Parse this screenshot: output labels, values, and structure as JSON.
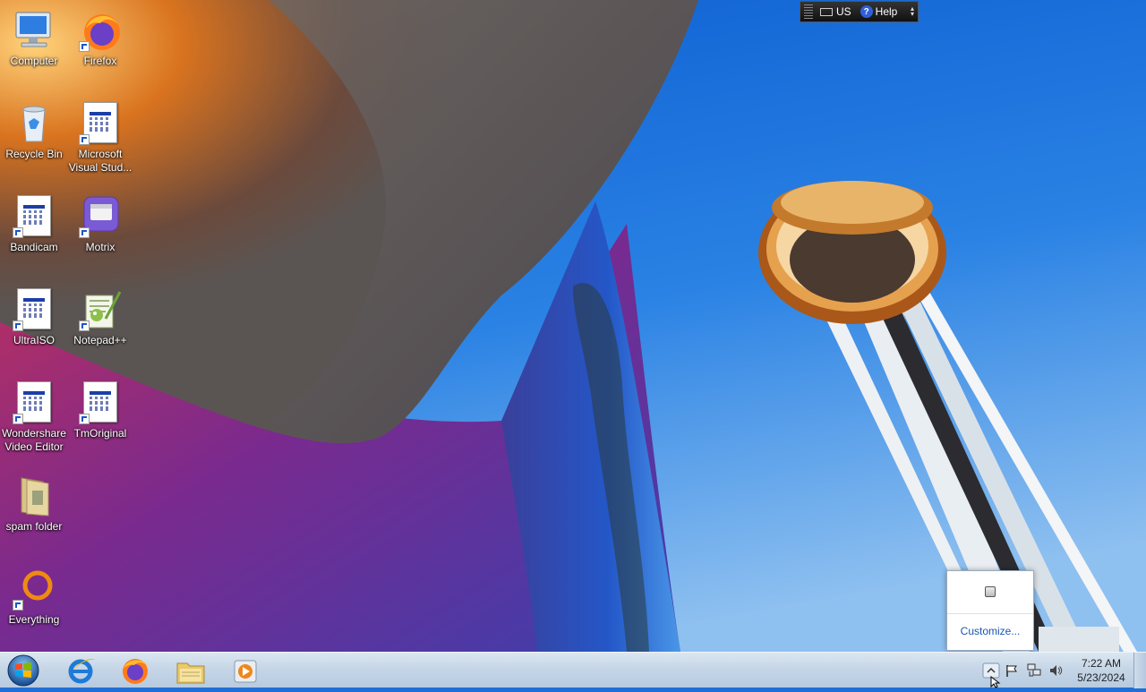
{
  "desktop": {
    "icons": [
      {
        "label": "Computer",
        "icon": "computer-icon"
      },
      {
        "label": "Firefox",
        "icon": "firefox-icon"
      },
      {
        "label": "Recycle Bin",
        "icon": "recycle-bin-icon"
      },
      {
        "label": "Microsoft Visual Stud...",
        "icon": "document-shortcut-icon"
      },
      {
        "label": "Bandicam",
        "icon": "document-shortcut-icon"
      },
      {
        "label": "Motrix",
        "icon": "motrix-icon"
      },
      {
        "label": "UltraISO",
        "icon": "document-shortcut-icon"
      },
      {
        "label": "Notepad++",
        "icon": "notepadpp-icon"
      },
      {
        "label": "Wondershare Video Editor",
        "icon": "document-shortcut-icon"
      },
      {
        "label": "TmOriginal",
        "icon": "document-shortcut-icon"
      },
      {
        "label": "spam folder",
        "icon": "folder-icon"
      },
      {
        "label": "Everything",
        "icon": "everything-icon"
      }
    ]
  },
  "language_bar": {
    "language": "US",
    "help_label": "Help"
  },
  "tray_popup": {
    "customize_label": "Customize..."
  },
  "taskbar": {
    "pinned": [
      {
        "icon": "internet-explorer-icon"
      },
      {
        "icon": "firefox-icon"
      },
      {
        "icon": "file-explorer-icon"
      },
      {
        "icon": "media-player-icon"
      }
    ],
    "tray_icons": [
      "show-hidden-icons-icon",
      "action-center-flag-icon",
      "network-icon",
      "volume-icon"
    ],
    "clock": {
      "time": "7:22 AM",
      "date": "5/23/2024"
    }
  },
  "colors": {
    "sky": "#1e6fd6",
    "taskbar": "#c6d6e7",
    "link": "#1a55b3"
  }
}
